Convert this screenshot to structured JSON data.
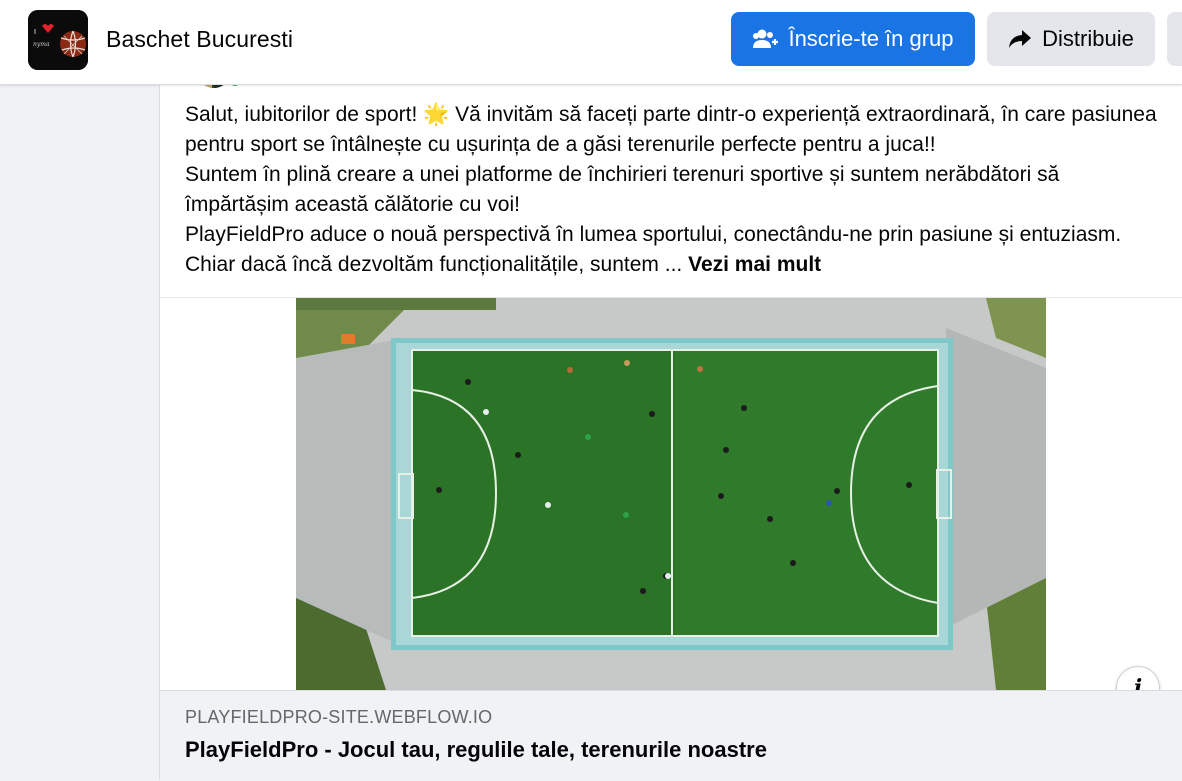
{
  "header": {
    "group_name": "Baschet Bucuresti",
    "join_label": "Înscrie-te în grup",
    "share_label": "Distribuie",
    "accent_color": "#1b74e4"
  },
  "icons": {
    "join": "people-plus-icon",
    "share": "share-arrow-icon",
    "info": "info-icon",
    "sparkle": "glowing-star-emoji"
  },
  "post": {
    "paragraphs": [
      "Salut, iubitorilor de sport! 🌟 Vă invităm să faceți parte dintr-o experiență extraordinară, în care pasiunea pentru sport se întâlnește cu ușurința de a găsi terenurile perfecte pentru a juca!!",
      "Suntem în plină creare a unei platforme  de închirieri terenuri sportive și suntem nerăbdători să împărtășim această călătorie cu voi!",
      "PlayFieldPro aduce o nouă perspectivă în lumea sportului, conectându-ne prin pasiune și entuziasm. Chiar dacă încă dezvoltăm funcționalitățile, suntem ..."
    ],
    "see_more": "Vezi mai mult"
  },
  "link_preview": {
    "domain": "PLAYFIELDPRO-SITE.WEBFLOW.IO",
    "title": "PlayFieldPro - Jocul tau, regulile tale, terenurile noastre"
  }
}
